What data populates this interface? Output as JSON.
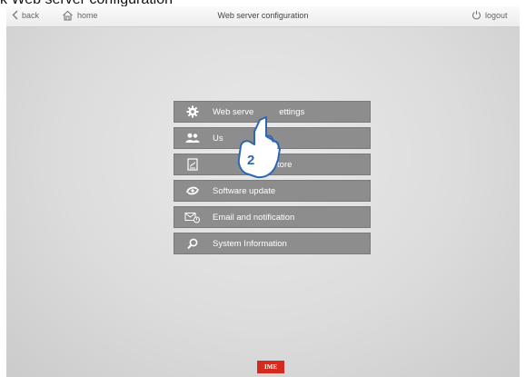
{
  "caption": "k  Web server configuration",
  "topbar": {
    "back_label": "back",
    "home_label": "home",
    "title": "Web server configuration",
    "logout_label": "logout"
  },
  "menu": {
    "items": [
      {
        "label": "Web serve",
        "label_tail": "ettings",
        "icon": "gear-icon"
      },
      {
        "label": "Us",
        "icon": "users-icon"
      },
      {
        "label": "",
        "label_tail": "estore",
        "icon": "backup-icon"
      },
      {
        "label": "Software update",
        "icon": "update-icon"
      },
      {
        "label": "Email and notification",
        "icon": "email-icon"
      },
      {
        "label": "System Information",
        "icon": "search-icon"
      }
    ]
  },
  "overlay": {
    "step_number": "2",
    "icon": "pointing-hand-icon"
  },
  "footer": {
    "logo_text": "IME"
  },
  "colors": {
    "menu_button": "#8d8d8d",
    "logo_red": "#d42b1e",
    "background": "#dcdcdc"
  }
}
